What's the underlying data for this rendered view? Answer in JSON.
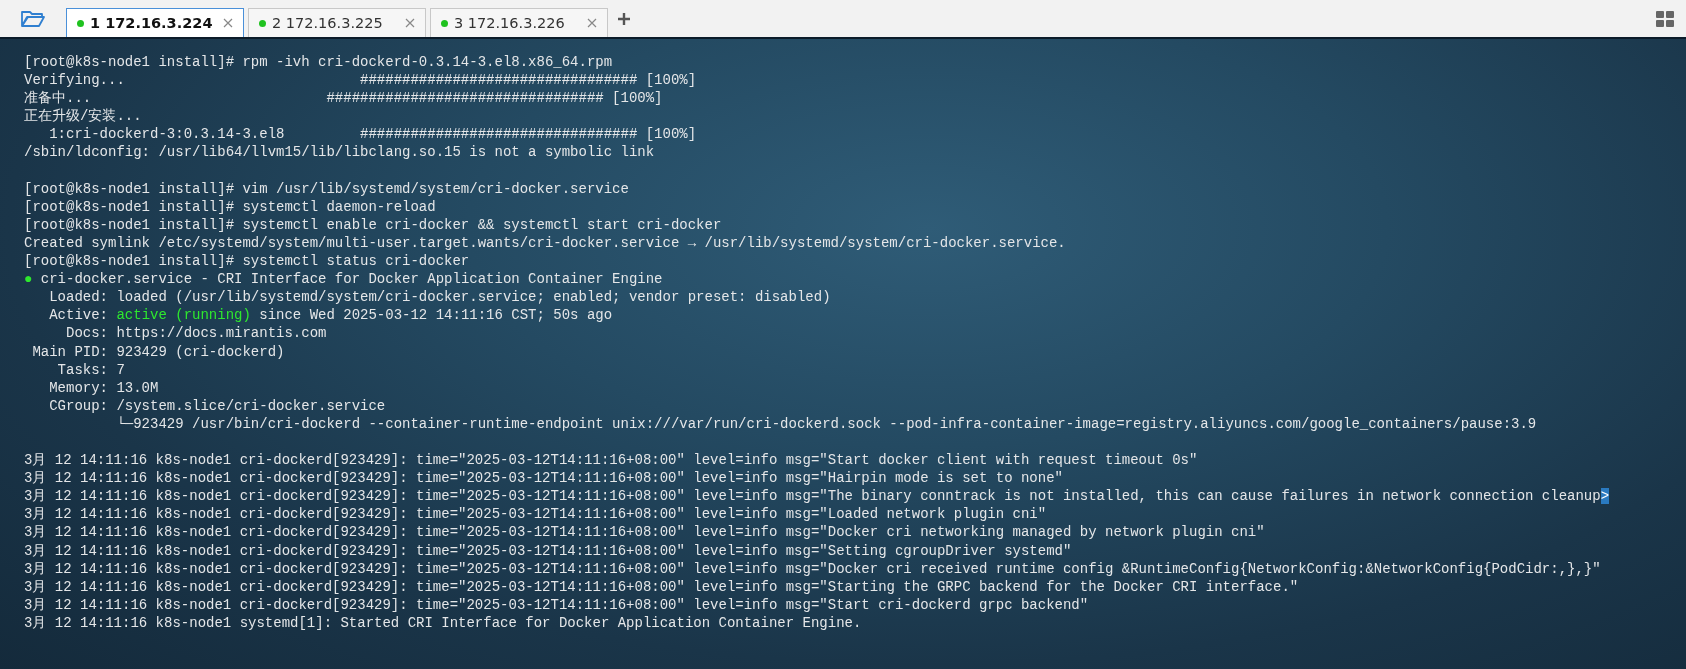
{
  "tabs": [
    {
      "label": "1 172.16.3.224",
      "selected": true,
      "color": "#1fc21f"
    },
    {
      "label": "2 172.16.3.225",
      "selected": false,
      "color": "#1fc21f"
    },
    {
      "label": "3 172.16.3.226",
      "selected": false,
      "color": "#1fc21f"
    }
  ],
  "terminal": {
    "lines": [
      {
        "kind": "text",
        "parts": [
          {
            "kind": "plain",
            "text": "[root@k8s-node1 install]# rpm -ivh cri-dockerd-0.3.14-3.el8.x86_64.rpm"
          }
        ]
      },
      {
        "kind": "text",
        "parts": [
          {
            "kind": "plain",
            "text": "Verifying...                            ################################# [100%]"
          }
        ]
      },
      {
        "kind": "text",
        "parts": [
          {
            "kind": "plain",
            "text": "准备中...                            ################################# [100%]"
          }
        ]
      },
      {
        "kind": "text",
        "parts": [
          {
            "kind": "plain",
            "text": "正在升级/安装..."
          }
        ]
      },
      {
        "kind": "text",
        "parts": [
          {
            "kind": "plain",
            "text": "   1:cri-dockerd-3:0.3.14-3.el8         ################################# [100%]"
          }
        ]
      },
      {
        "kind": "text",
        "parts": [
          {
            "kind": "plain",
            "text": "/sbin/ldconfig: /usr/lib64/llvm15/lib/libclang.so.15 is not a symbolic link"
          }
        ]
      },
      {
        "kind": "blank"
      },
      {
        "kind": "text",
        "parts": [
          {
            "kind": "plain",
            "text": "[root@k8s-node1 install]# vim /usr/lib/systemd/system/cri-docker.service"
          }
        ]
      },
      {
        "kind": "text",
        "parts": [
          {
            "kind": "plain",
            "text": "[root@k8s-node1 install]# systemctl daemon-reload"
          }
        ]
      },
      {
        "kind": "text",
        "parts": [
          {
            "kind": "plain",
            "text": "[root@k8s-node1 install]# systemctl enable cri-docker && systemctl start cri-docker"
          }
        ]
      },
      {
        "kind": "text",
        "parts": [
          {
            "kind": "plain",
            "text": "Created symlink /etc/systemd/system/multi-user.target.wants/cri-docker.service → /usr/lib/systemd/system/cri-docker.service."
          }
        ]
      },
      {
        "kind": "text",
        "parts": [
          {
            "kind": "plain",
            "text": "[root@k8s-node1 install]# systemctl status cri-docker"
          }
        ]
      },
      {
        "kind": "text",
        "parts": [
          {
            "kind": "green",
            "text": "●"
          },
          {
            "kind": "plain",
            "text": " cri-docker.service - CRI Interface for Docker Application Container Engine"
          }
        ]
      },
      {
        "kind": "text",
        "parts": [
          {
            "kind": "plain",
            "text": "   Loaded: loaded (/usr/lib/systemd/system/cri-docker.service; enabled; vendor preset: disabled)"
          }
        ]
      },
      {
        "kind": "text",
        "parts": [
          {
            "kind": "plain",
            "text": "   Active: "
          },
          {
            "kind": "green",
            "text": "active (running)"
          },
          {
            "kind": "plain",
            "text": " since Wed 2025-03-12 14:11:16 CST; 50s ago"
          }
        ]
      },
      {
        "kind": "text",
        "parts": [
          {
            "kind": "plain",
            "text": "     Docs: https://docs.mirantis.com"
          }
        ]
      },
      {
        "kind": "text",
        "parts": [
          {
            "kind": "plain",
            "text": " Main PID: 923429 (cri-dockerd)"
          }
        ]
      },
      {
        "kind": "text",
        "parts": [
          {
            "kind": "plain",
            "text": "    Tasks: 7"
          }
        ]
      },
      {
        "kind": "text",
        "parts": [
          {
            "kind": "plain",
            "text": "   Memory: 13.0M"
          }
        ]
      },
      {
        "kind": "text",
        "parts": [
          {
            "kind": "plain",
            "text": "   CGroup: /system.slice/cri-docker.service"
          }
        ]
      },
      {
        "kind": "text",
        "parts": [
          {
            "kind": "plain",
            "text": "           └─923429 /usr/bin/cri-dockerd --container-runtime-endpoint unix:///var/run/cri-dockerd.sock --pod-infra-container-image=registry.aliyuncs.com/google_containers/pause:3.9"
          }
        ]
      },
      {
        "kind": "blank"
      },
      {
        "kind": "text",
        "parts": [
          {
            "kind": "plain",
            "text": "3月 12 14:11:16 k8s-node1 cri-dockerd[923429]: time=\"2025-03-12T14:11:16+08:00\" level=info msg=\"Start docker client with request timeout 0s\""
          }
        ]
      },
      {
        "kind": "text",
        "parts": [
          {
            "kind": "plain",
            "text": "3月 12 14:11:16 k8s-node1 cri-dockerd[923429]: time=\"2025-03-12T14:11:16+08:00\" level=info msg=\"Hairpin mode is set to none\""
          }
        ]
      },
      {
        "kind": "text",
        "parts": [
          {
            "kind": "plain",
            "text": "3月 12 14:11:16 k8s-node1 cri-dockerd[923429]: time=\"2025-03-12T14:11:16+08:00\" level=info msg=\"The binary conntrack is not installed, this can cause failures in network connection cleanup"
          },
          {
            "kind": "cursor",
            "text": ">"
          }
        ]
      },
      {
        "kind": "text",
        "parts": [
          {
            "kind": "plain",
            "text": "3月 12 14:11:16 k8s-node1 cri-dockerd[923429]: time=\"2025-03-12T14:11:16+08:00\" level=info msg=\"Loaded network plugin cni\""
          }
        ]
      },
      {
        "kind": "text",
        "parts": [
          {
            "kind": "plain",
            "text": "3月 12 14:11:16 k8s-node1 cri-dockerd[923429]: time=\"2025-03-12T14:11:16+08:00\" level=info msg=\"Docker cri networking managed by network plugin cni\""
          }
        ]
      },
      {
        "kind": "text",
        "parts": [
          {
            "kind": "plain",
            "text": "3月 12 14:11:16 k8s-node1 cri-dockerd[923429]: time=\"2025-03-12T14:11:16+08:00\" level=info msg=\"Setting cgroupDriver systemd\""
          }
        ]
      },
      {
        "kind": "text",
        "parts": [
          {
            "kind": "plain",
            "text": "3月 12 14:11:16 k8s-node1 cri-dockerd[923429]: time=\"2025-03-12T14:11:16+08:00\" level=info msg=\"Docker cri received runtime config &RuntimeConfig{NetworkConfig:&NetworkConfig{PodCidr:,},}\""
          }
        ]
      },
      {
        "kind": "text",
        "parts": [
          {
            "kind": "plain",
            "text": "3月 12 14:11:16 k8s-node1 cri-dockerd[923429]: time=\"2025-03-12T14:11:16+08:00\" level=info msg=\"Starting the GRPC backend for the Docker CRI interface.\""
          }
        ]
      },
      {
        "kind": "text",
        "parts": [
          {
            "kind": "plain",
            "text": "3月 12 14:11:16 k8s-node1 cri-dockerd[923429]: time=\"2025-03-12T14:11:16+08:00\" level=info msg=\"Start cri-dockerd grpc backend\""
          }
        ]
      },
      {
        "kind": "text",
        "parts": [
          {
            "kind": "plain",
            "text": "3月 12 14:11:16 k8s-node1 systemd[1]: Started CRI Interface for Docker Application Container Engine."
          }
        ]
      }
    ]
  }
}
